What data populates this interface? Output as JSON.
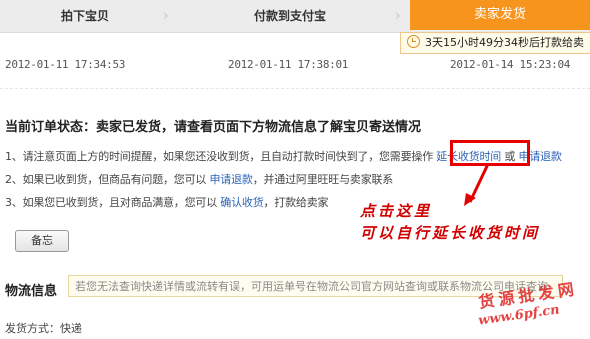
{
  "steps": {
    "s1": "拍下宝贝",
    "s2": "付款到支付宝",
    "s3": "卖家发货",
    "chevron": "›"
  },
  "timer": {
    "text": "3天15小时49分34秒后打款给卖"
  },
  "timestamps": [
    "2012-01-11 17:34:53",
    "2012-01-11 17:38:01",
    "2012-01-14 15:23:04"
  ],
  "status": {
    "label": "当前订单状态：",
    "text": "卖家已发货，请查看页面下方物流信息了解宝贝寄送情况"
  },
  "items": [
    {
      "pre": "1、请注意页面上方的时间提醒，如果您还没收到货，且自动打款时间快到了，您需要操作 ",
      "link1": "延长收货时间",
      "mid": " 或 ",
      "link2": "申请退款",
      "post": ""
    },
    {
      "pre": "2、如果已收到货，但商品有问题，您可以 ",
      "link1": "申请退款",
      "post": "，并通过阿里旺旺与卖家联系"
    },
    {
      "pre": "3、如果您已收到货，且对商品满意，您可以 ",
      "link1": "确认收货",
      "post": "，打款给卖家"
    }
  ],
  "memo_button": "备忘",
  "annotation": {
    "line1": "点击这里",
    "line2": "可以自行延长收货时间"
  },
  "logistics": {
    "title": "物流信息",
    "note": "若您无法查询快递详情或流转有误，可用运单号在物流公司官方网站查询或联系物流公司电话查询"
  },
  "shipping": {
    "label": "发货方式：",
    "value": "快递"
  },
  "watermark": {
    "line1": "货源批发网",
    "line2": "www.6pf.cn"
  },
  "colors": {
    "accent": "#f7941d",
    "link": "#2d63b8",
    "annotation": "#e60000"
  }
}
